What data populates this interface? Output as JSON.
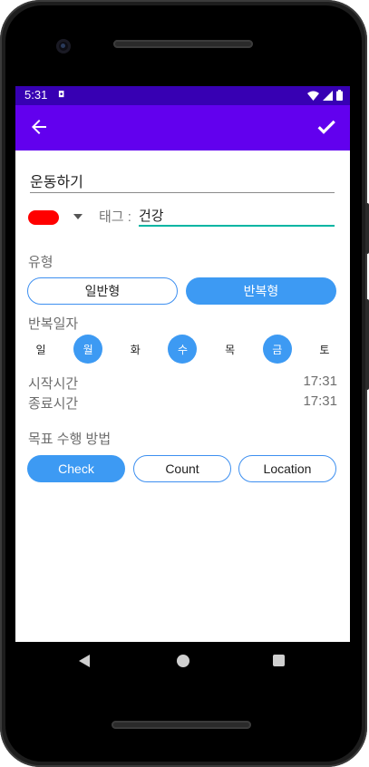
{
  "status": {
    "time": "5:31"
  },
  "toolbar": {
    "back_icon": "arrow-left-icon",
    "save_icon": "check-icon"
  },
  "form": {
    "title_value": "운동하기",
    "color": "#ff0000",
    "tag_label": "태그 :",
    "tag_value": "건강"
  },
  "type_section": {
    "label": "유형",
    "options": [
      {
        "label": "일반형",
        "selected": false
      },
      {
        "label": "반복형",
        "selected": true
      }
    ]
  },
  "repeat_section": {
    "label": "반복일자",
    "days": [
      {
        "label": "일",
        "selected": false
      },
      {
        "label": "월",
        "selected": true
      },
      {
        "label": "화",
        "selected": false
      },
      {
        "label": "수",
        "selected": true
      },
      {
        "label": "목",
        "selected": false
      },
      {
        "label": "금",
        "selected": true
      },
      {
        "label": "토",
        "selected": false
      }
    ]
  },
  "times": {
    "start_label": "시작시간",
    "start_value": "17:31",
    "end_label": "종료시간",
    "end_value": "17:31"
  },
  "goal_section": {
    "label": "목표 수행 방법",
    "options": [
      {
        "label": "Check",
        "selected": true
      },
      {
        "label": "Count",
        "selected": false
      },
      {
        "label": "Location",
        "selected": false
      }
    ]
  },
  "colors": {
    "statusbar": "#3700b3",
    "appbar": "#6200ee",
    "accent": "#3d9af3",
    "tag_underline": "#00b5a3"
  }
}
